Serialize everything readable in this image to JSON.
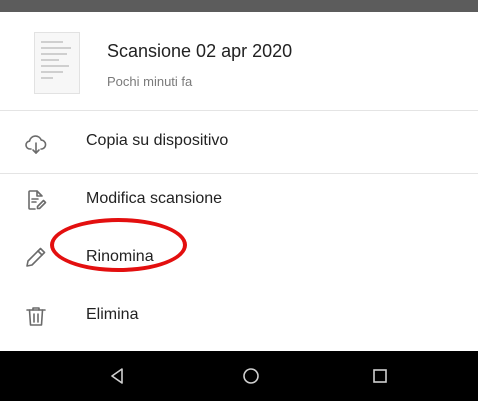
{
  "file": {
    "title": "Scansione 02 apr 2020",
    "subtitle": "Pochi minuti fa",
    "thumbnail_icon": "document-thumbnail"
  },
  "menu": {
    "items": [
      {
        "label": "Copia su dispositivo",
        "icon": "cloud-download-icon"
      },
      {
        "label": "Modifica scansione",
        "icon": "edit-document-icon"
      },
      {
        "label": "Rinomina",
        "icon": "pencil-icon"
      },
      {
        "label": "Elimina",
        "icon": "trash-icon"
      }
    ]
  },
  "annotation": {
    "type": "circle-highlight",
    "target": "Rinomina",
    "color": "#e30f0f"
  },
  "navigation_bar": {
    "buttons": [
      "back-icon",
      "home-icon",
      "recents-icon"
    ]
  },
  "colors": {
    "text": "#222222",
    "subtext": "#7a7a7a",
    "icon": "#6b6b6b",
    "nav_background": "#000000",
    "status_bar": "#5c5c5c"
  }
}
